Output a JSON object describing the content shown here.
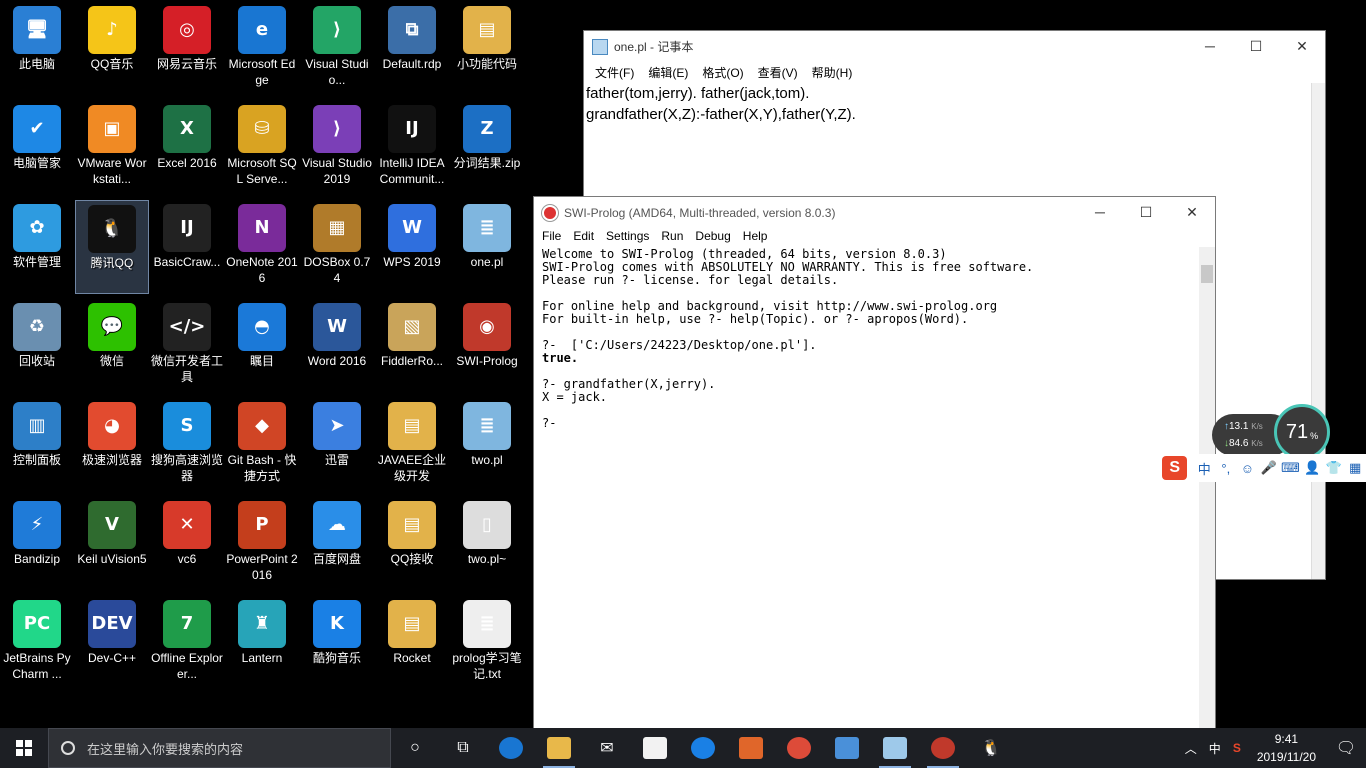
{
  "desktop": {
    "icons": [
      {
        "label": "此电脑",
        "glyph": "🖥",
        "color": "#2a7fd4"
      },
      {
        "label": "QQ音乐",
        "glyph": "♪",
        "color": "#f5c518"
      },
      {
        "label": "网易云音乐",
        "glyph": "◎",
        "color": "#d51f27"
      },
      {
        "label": "Microsoft Edge",
        "glyph": "e",
        "color": "#1976d2"
      },
      {
        "label": "Visual Studio...",
        "glyph": "⟩",
        "color": "#23a566"
      },
      {
        "label": "Default.rdp",
        "glyph": "⧉",
        "color": "#3b6ea8"
      },
      {
        "label": "小功能代码",
        "glyph": "▤",
        "color": "#e2b24a"
      },
      {
        "label": "电脑管家",
        "glyph": "✔",
        "color": "#1e88e5"
      },
      {
        "label": "VMware Workstati...",
        "glyph": "▣",
        "color": "#f08a24"
      },
      {
        "label": "Excel 2016",
        "glyph": "X",
        "color": "#1e7145"
      },
      {
        "label": "Microsoft SQL Serve...",
        "glyph": "⛁",
        "color": "#d9a322"
      },
      {
        "label": "Visual Studio 2019",
        "glyph": "⟩",
        "color": "#7b3fb7"
      },
      {
        "label": "IntelliJ IDEA Communit...",
        "glyph": "IJ",
        "color": "#111"
      },
      {
        "label": "分词结果.zip",
        "glyph": "Z",
        "color": "#1c6fc4"
      },
      {
        "label": "软件管理",
        "glyph": "✿",
        "color": "#2e9be0"
      },
      {
        "label": "腾讯QQ",
        "glyph": "🐧",
        "color": "#111"
      },
      {
        "label": "BasicCraw...",
        "glyph": "IJ",
        "color": "#222"
      },
      {
        "label": "OneNote 2016",
        "glyph": "N",
        "color": "#7a2b9a"
      },
      {
        "label": "DOSBox 0.74",
        "glyph": "▦",
        "color": "#b07b2a"
      },
      {
        "label": "WPS 2019",
        "glyph": "W",
        "color": "#2f6fde"
      },
      {
        "label": "one.pl",
        "glyph": "≣",
        "color": "#7fb6df"
      },
      {
        "label": "回收站",
        "glyph": "♻",
        "color": "#6a8fb0"
      },
      {
        "label": "微信",
        "glyph": "💬",
        "color": "#2dc100"
      },
      {
        "label": "微信开发者工具",
        "glyph": "</>",
        "color": "#222"
      },
      {
        "label": "瞩目",
        "glyph": "◓",
        "color": "#1b79d8"
      },
      {
        "label": "Word 2016",
        "glyph": "W",
        "color": "#2b579a"
      },
      {
        "label": "FiddlerRo...",
        "glyph": "▧",
        "color": "#c9a45a"
      },
      {
        "label": "SWI-Prolog",
        "glyph": "◉",
        "color": "#c0392b"
      },
      {
        "label": "控制面板",
        "glyph": "▥",
        "color": "#2d7fc8"
      },
      {
        "label": "极速浏览器",
        "glyph": "◕",
        "color": "#e24b2f"
      },
      {
        "label": "搜狗高速浏览器",
        "glyph": "S",
        "color": "#1a8ddc"
      },
      {
        "label": "Git Bash - 快捷方式",
        "glyph": "◆",
        "color": "#d04525"
      },
      {
        "label": "迅雷",
        "glyph": "➤",
        "color": "#3b7fe0"
      },
      {
        "label": "JAVAEE企业级开发",
        "glyph": "▤",
        "color": "#e2b24a"
      },
      {
        "label": "two.pl",
        "glyph": "≣",
        "color": "#7fb6df"
      },
      {
        "label": "Bandizip",
        "glyph": "⚡",
        "color": "#1f7bd8"
      },
      {
        "label": "Keil uVision5",
        "glyph": "V",
        "color": "#2f6b2f"
      },
      {
        "label": "vc6",
        "glyph": "✕",
        "color": "#d73a2a"
      },
      {
        "label": "PowerPoint 2016",
        "glyph": "P",
        "color": "#c43e1c"
      },
      {
        "label": "百度网盘",
        "glyph": "☁",
        "color": "#2a8ee8"
      },
      {
        "label": "QQ接收",
        "glyph": "▤",
        "color": "#e2b24a"
      },
      {
        "label": "two.pl~",
        "glyph": "▯",
        "color": "#ddd"
      },
      {
        "label": "JetBrains PyCharm ...",
        "glyph": "PC",
        "color": "#21d789"
      },
      {
        "label": "Dev-C++",
        "glyph": "DEV",
        "color": "#2a4a9a"
      },
      {
        "label": "Offline Explorer...",
        "glyph": "7",
        "color": "#1f9c4a"
      },
      {
        "label": "Lantern",
        "glyph": "♜",
        "color": "#27a4b8"
      },
      {
        "label": "酷狗音乐",
        "glyph": "K",
        "color": "#1a80e5"
      },
      {
        "label": "Rocket",
        "glyph": "▤",
        "color": "#e2b24a"
      },
      {
        "label": "prolog学习笔记.txt",
        "glyph": "≣",
        "color": "#eee"
      }
    ]
  },
  "notepad": {
    "title": "one.pl - 记事本",
    "menu": [
      "文件(F)",
      "编辑(E)",
      "格式(O)",
      "查看(V)",
      "帮助(H)"
    ],
    "content": "father(tom,jerry). father(jack,tom).\ngrandfather(X,Z):-father(X,Y),father(Y,Z)."
  },
  "prolog": {
    "title": "SWI-Prolog (AMD64, Multi-threaded, version 8.0.3)",
    "menu": [
      "File",
      "Edit",
      "Settings",
      "Run",
      "Debug",
      "Help"
    ],
    "lines": [
      "Welcome to SWI-Prolog (threaded, 64 bits, version 8.0.3)",
      "SWI-Prolog comes with ABSOLUTELY NO WARRANTY. This is free software.",
      "Please run ?- license. for legal details.",
      "",
      "For online help and background, visit http://www.swi-prolog.org",
      "For built-in help, use ?- help(Topic). or ?- apropos(Word).",
      "",
      "?-  ['C:/Users/24223/Desktop/one.pl'].",
      "true.",
      "",
      "?- grandfather(X,jerry).",
      "X = jack.",
      "",
      "?-"
    ]
  },
  "netmon": {
    "up": "13.1",
    "up_unit": "K/s",
    "down": "84.6",
    "down_unit": "K/s",
    "percent": "71",
    "percent_unit": "%"
  },
  "ime": {
    "logo": "S",
    "lang": "中",
    "punct": "°,"
  },
  "taskbar": {
    "search_placeholder": "在这里输入你要搜索的内容",
    "tray_lang": "中",
    "clock_time": "9:41",
    "clock_date": "2019/11/20"
  }
}
